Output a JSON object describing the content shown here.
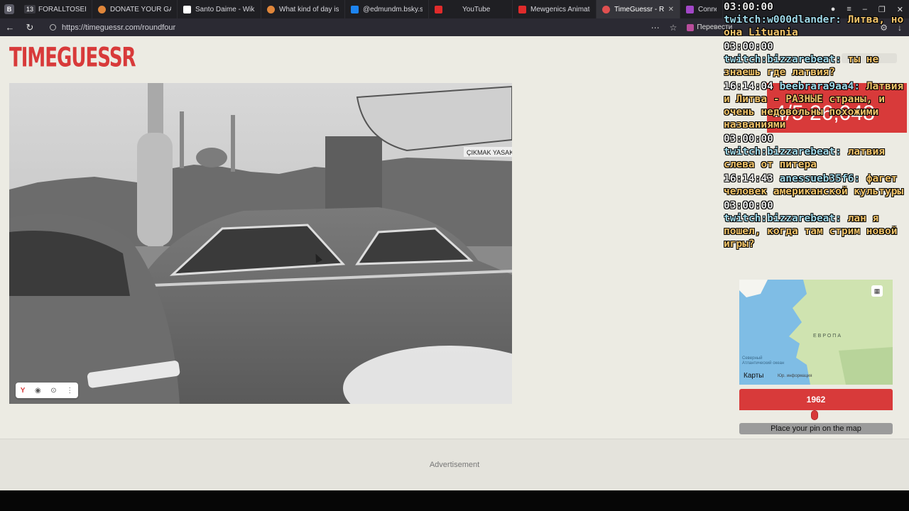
{
  "tabs": [
    {
      "label": "FORALLTOSEE",
      "count": "13",
      "color": "#3a3a41"
    },
    {
      "label": "DONATE YOUR GAME",
      "color": "#e0863a"
    },
    {
      "label": "Santo Daime - Wikipe",
      "color": "#ffffff"
    },
    {
      "label": "What kind of day is it?",
      "color": "#e0863a"
    },
    {
      "label": "@edmundm.bsky.soc",
      "color": "#1d84f0"
    },
    {
      "label": "YouTube",
      "color": "#e02b2b"
    },
    {
      "label": "Mewgenics Animated",
      "color": "#e02b2b"
    },
    {
      "label": "TimeGuessr - Roun",
      "color": "#e05050"
    },
    {
      "label": "Connecti",
      "color": "#a247c7"
    }
  ],
  "address": {
    "url": "https://timeguessr.com/roundfour",
    "translate_label": "Перевести"
  },
  "page": {
    "logo": "TIMEGUESSR",
    "score": "4/5 26,048",
    "year": "1962",
    "pin_button": "Place your pin on the map",
    "advertisement": "Advertisement",
    "photo_sign": "ÇIKMAK YASAK",
    "photo_tools": {
      "y": "Y",
      "eye": "◉",
      "lens": "⊙",
      "more": "⋮"
    }
  },
  "map": {
    "europa": "ЕВРОПА",
    "ocean": "Северный Атлантический океан",
    "karty": "Карты",
    "legal": "Юр. информация"
  },
  "chat": [
    {
      "ts": "03:00:00",
      "user": "twitch:w000dlander:",
      "msg": "Литва, но она Lituania"
    },
    {
      "ts": "03:00:00",
      "user": "twitch:bizzarebeat:",
      "msg": "ты не знаешь где латвия?"
    },
    {
      "ts": "16:14:04",
      "user": "beebrara9aa4:",
      "msg": "Латвия и Литва - РАЗНЫЕ страны, и очень недовольны похожими названиями"
    },
    {
      "ts": "03:00:00",
      "user": "twitch:bizzarebeat:",
      "msg": "латвия слева от питера"
    },
    {
      "ts": "16:14:43",
      "user": "anessueb35f6:",
      "msg": "фагет человек американской культуры"
    },
    {
      "ts": "03:00:00",
      "user": "twitch:bizzarebeat:",
      "msg": "лан я пошел, когда там стрим новой игры?"
    }
  ],
  "colors": {
    "accent": "#d83a3a",
    "page_bg": "#ecebe3"
  }
}
